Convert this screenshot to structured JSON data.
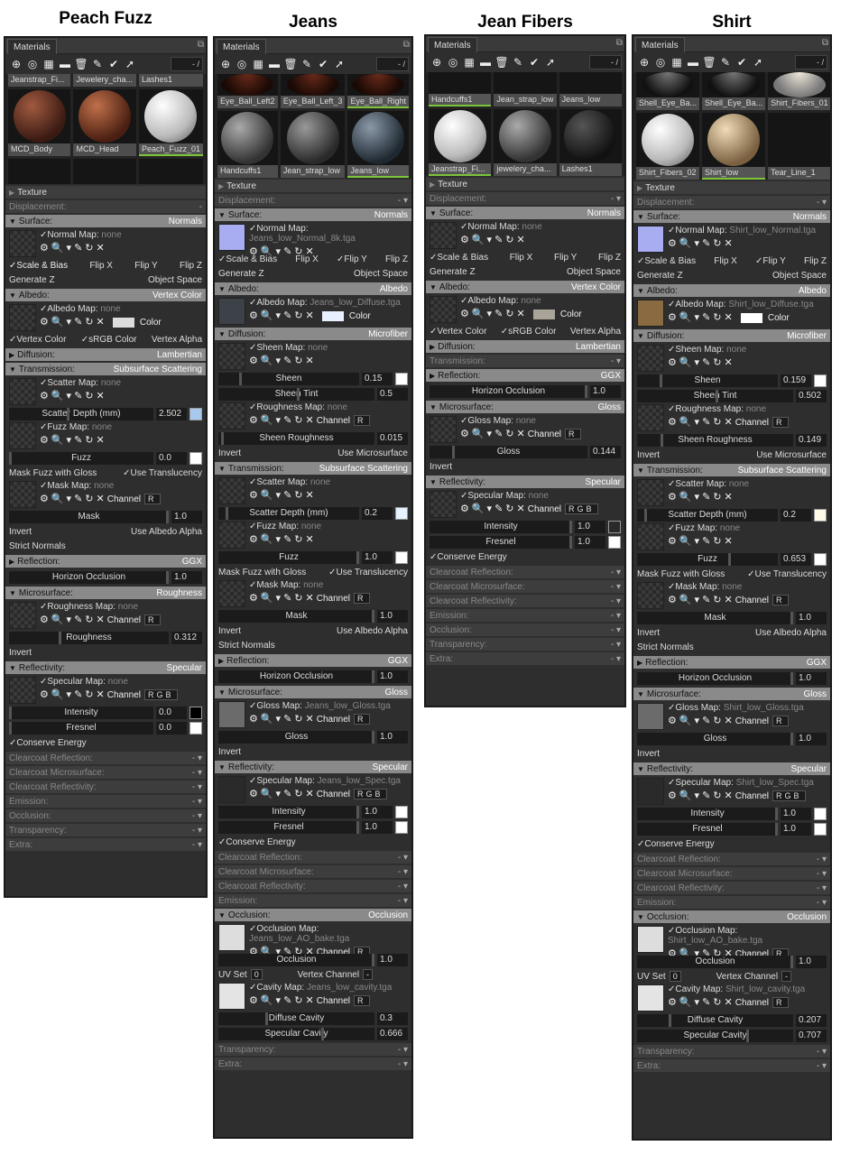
{
  "titles": [
    "Peach Fuzz",
    "Jeans",
    "Jean Fibers",
    "Shirt"
  ],
  "tab": "Materials",
  "pager": "- /",
  "icons": {
    "new": "plus-circle-icon",
    "dup": "duplicate-icon",
    "checker": "checker-icon",
    "folder": "folder-icon",
    "trash": "trash-icon",
    "eyedrop": "eyedropper-icon",
    "check": "check-circle-icon",
    "import": "import-icon"
  },
  "p1": {
    "thumb_labels": [
      "Jeanstrap_Fi...",
      "Jewelery_cha...",
      "Lashes1",
      "MCD_Body",
      "MCD_Head",
      "Peach_Fuzz_01"
    ],
    "texture": "Texture",
    "displacement": "Displacement:",
    "dv": "-",
    "surface": "Surface:",
    "surface_v": "Normals",
    "normal_map": "Normal Map:",
    "none": "none",
    "scale_bias": "Scale & Bias",
    "flip_x": "Flip X",
    "flip_y": "Flip Y",
    "flip_z": "Flip Z",
    "gen_z": "Generate Z",
    "obj_space": "Object Space",
    "albedo": "Albedo:",
    "albedo_v": "Vertex Color",
    "albedo_map": "Albedo Map:",
    "color": "Color",
    "vertex_color": "Vertex Color",
    "srgb": "sRGB Color",
    "vertex_alpha": "Vertex Alpha",
    "diffusion": "Diffusion:",
    "diffusion_v": "Lambertian",
    "transmission": "Transmission:",
    "transmission_v": "Subsurface Scattering",
    "scatter_map": "Scatter Map:",
    "scatter_depth": "Scatter Depth (mm)",
    "scatter_depth_v": "2.502",
    "fuzz_map": "Fuzz Map:",
    "fuzz": "Fuzz",
    "fuzz_v": "0.0",
    "mask_fuzz": "Mask Fuzz with Gloss",
    "use_transl": "Use Translucency",
    "mask_map": "Mask Map:",
    "channel": "Channel",
    "ch_r": "R",
    "mask": "Mask",
    "mask_v": "1.0",
    "invert": "Invert",
    "use_albedo_alpha": "Use Albedo Alpha",
    "strict": "Strict Normals",
    "reflection": "Reflection:",
    "reflection_v": "GGX",
    "horizon": "Horizon Occlusion",
    "horizon_v": "1.0",
    "microsurface": "Microsurface:",
    "micro_v": "Roughness",
    "rough_map": "Roughness Map:",
    "roughness": "Roughness",
    "roughness_v": "0.312",
    "invert2": "Invert",
    "reflectivity": "Reflectivity:",
    "refl_v": "Specular",
    "spec_map": "Specular Map:",
    "ch_rgb": "RGB",
    "intensity": "Intensity",
    "intensity_v": "0.0",
    "fresnel": "Fresnel",
    "fresnel_v": "0.0",
    "conserve": "Conserve Energy",
    "disabled": [
      "Clearcoat Reflection:",
      "Clearcoat Microsurface:",
      "Clearcoat Reflectivity:",
      "Emission:",
      "Occlusion:",
      "Transparency:",
      "Extra:"
    ]
  },
  "p2": {
    "thumb_labels": [
      "Eye_Ball_Left2",
      "Eye_Ball_Left_3",
      "Eye_Ball_Right",
      "Handcuffs1",
      "Jean_strap_low",
      "Jeans_low"
    ],
    "texture": "Texture",
    "displacement": "Displacement:",
    "surface": "Surface:",
    "surface_v": "Normals",
    "normal_map": "Normal Map:",
    "normal_file": "Jeans_low_Normal_8k.tga",
    "scale_bias": "Scale & Bias",
    "flip_x": "Flip X",
    "flip_y": "Flip Y",
    "flip_z": "Flip Z",
    "gen_z": "Generate Z",
    "obj_space": "Object Space",
    "albedo": "Albedo:",
    "albedo_v": "Albedo",
    "albedo_map": "Albedo Map:",
    "albedo_file": "Jeans_low_Diffuse.tga",
    "color": "Color",
    "diffusion": "Diffusion:",
    "diffusion_v": "Microfiber",
    "sheen_map": "Sheen Map:",
    "none": "none",
    "sheen": "Sheen",
    "sheen_v": "0.15",
    "sheen_tint": "Sheen Tint",
    "sheen_tint_v": "0.5",
    "rough_map": "Roughness Map:",
    "channel": "Channel",
    "ch_r": "R",
    "sheen_rough": "Sheen Roughness",
    "sheen_rough_v": "0.015",
    "invert": "Invert",
    "use_micro": "Use Microsurface",
    "transmission": "Transmission:",
    "transmission_v": "Subsurface Scattering",
    "scatter_map": "Scatter Map:",
    "scatter_depth": "Scatter Depth (mm)",
    "scatter_depth_v": "0.2",
    "fuzz_map": "Fuzz Map:",
    "fuzz": "Fuzz",
    "fuzz_v": "1.0",
    "mask_fuzz": "Mask Fuzz with Gloss",
    "use_transl": "Use Translucency",
    "mask_map": "Mask Map:",
    "mask": "Mask",
    "mask_v": "1.0",
    "use_albedo_alpha": "Use Albedo Alpha",
    "strict": "Strict Normals",
    "reflection": "Reflection:",
    "reflection_v": "GGX",
    "horizon": "Horizon Occlusion",
    "horizon_v": "1.0",
    "microsurface": "Microsurface:",
    "micro_v": "Gloss",
    "gloss_map": "Gloss Map:",
    "gloss_file": "Jeans_low_Gloss.tga",
    "gloss": "Gloss",
    "gloss_v": "1.0",
    "reflectivity": "Reflectivity:",
    "refl_v": "Specular",
    "spec_map": "Specular Map:",
    "spec_file": "Jeans_low_Spec.tga",
    "ch_rgb": "RGB",
    "intensity": "Intensity",
    "intensity_v": "1.0",
    "fresnel": "Fresnel",
    "fresnel_v": "1.0",
    "conserve": "Conserve Energy",
    "disabled": [
      "Clearcoat Reflection:",
      "Clearcoat Microsurface:",
      "Clearcoat Reflectivity:",
      "Emission:"
    ],
    "occlusion": "Occlusion:",
    "occlusion_v": "Occlusion",
    "occ_map": "Occlusion Map:",
    "occ_file": "Jeans_low_AO_bake.tga",
    "occ": "Occlusion",
    "occ_v": "1.0",
    "uv_set": "UV Set",
    "uv_v": "0",
    "vertex_channel": "Vertex Channel",
    "vc_v": "-",
    "cavity_map": "Cavity Map:",
    "cavity_file": "Jeans_low_cavity.tga",
    "diffuse_cavity": "Diffuse Cavity",
    "diffuse_cavity_v": "0.3",
    "spec_cavity": "Specular Cavity",
    "spec_cavity_v": "0.666",
    "disabled2": [
      "Transparency:",
      "Extra:"
    ]
  },
  "p3": {
    "thumb_labels": [
      "Handcuffs1",
      "Jean_strap_low",
      "Jeans_low",
      "Jeanstrap_Fi...",
      "jewelery_cha...",
      "Lashes1"
    ],
    "texture": "Texture",
    "displacement": "Displacement:",
    "surface": "Surface:",
    "surface_v": "Normals",
    "normal_map": "Normal Map:",
    "none": "none",
    "scale_bias": "Scale & Bias",
    "flip_x": "Flip X",
    "flip_y": "Flip Y",
    "flip_z": "Flip Z",
    "gen_z": "Generate Z",
    "obj_space": "Object Space",
    "albedo": "Albedo:",
    "albedo_v": "Vertex Color",
    "albedo_map": "Albedo Map:",
    "color": "Color",
    "vertex_color": "Vertex Color",
    "srgb": "sRGB Color",
    "vertex_alpha": "Vertex Alpha",
    "diffusion": "Diffusion:",
    "diffusion_v": "Lambertian",
    "transmission": "Transmission:",
    "reflection": "Reflection:",
    "reflection_v": "GGX",
    "horizon": "Horizon Occlusion",
    "horizon_v": "1.0",
    "microsurface": "Microsurface:",
    "micro_v": "Gloss",
    "gloss_map": "Gloss Map:",
    "channel": "Channel",
    "ch_r": "R",
    "gloss": "Gloss",
    "gloss_v": "0.144",
    "invert": "Invert",
    "reflectivity": "Reflectivity:",
    "refl_v": "Specular",
    "spec_map": "Specular Map:",
    "ch_rgb": "RGB",
    "intensity": "Intensity",
    "intensity_v": "1.0",
    "fresnel": "Fresnel",
    "fresnel_v": "1.0",
    "conserve": "Conserve Energy",
    "disabled": [
      "Clearcoat Reflection:",
      "Clearcoat Microsurface:",
      "Clearcoat Reflectivity:",
      "Emission:",
      "Occlusion:",
      "Transparency:",
      "Extra:"
    ]
  },
  "p4": {
    "thumb_labels": [
      "Shell_Eye_Ba...",
      "Shell_Eye_Ba...",
      "Shirt_Fibers_01",
      "Shirt_Fibers_02",
      "Shirt_low",
      "Tear_Line_1"
    ],
    "texture": "Texture",
    "displacement": "Displacement:",
    "surface": "Surface:",
    "surface_v": "Normals",
    "normal_map": "Normal Map:",
    "normal_file": "Shirt_low_Normal.tga",
    "scale_bias": "Scale & Bias",
    "flip_x": "Flip X",
    "flip_y": "Flip Y",
    "flip_z": "Flip Z",
    "gen_z": "Generate Z",
    "obj_space": "Object Space",
    "albedo": "Albedo:",
    "albedo_v": "Albedo",
    "albedo_map": "Albedo Map:",
    "albedo_file": "Shirt_low_Diffuse.tga",
    "color": "Color",
    "diffusion": "Diffusion:",
    "diffusion_v": "Microfiber",
    "sheen_map": "Sheen Map:",
    "none": "none",
    "sheen": "Sheen",
    "sheen_v": "0.159",
    "sheen_tint": "Sheen Tint",
    "sheen_tint_v": "0.502",
    "rough_map": "Roughness Map:",
    "channel": "Channel",
    "ch_r": "R",
    "sheen_rough": "Sheen Roughness",
    "sheen_rough_v": "0.149",
    "invert": "Invert",
    "use_micro": "Use Microsurface",
    "transmission": "Transmission:",
    "transmission_v": "Subsurface Scattering",
    "scatter_map": "Scatter Map:",
    "scatter_depth": "Scatter Depth (mm)",
    "scatter_depth_v": "0.2",
    "fuzz_map": "Fuzz Map:",
    "fuzz": "Fuzz",
    "fuzz_v": "0.653",
    "mask_fuzz": "Mask Fuzz with Gloss",
    "use_transl": "Use Translucency",
    "mask_map": "Mask Map:",
    "mask": "Mask",
    "mask_v": "1.0",
    "use_albedo_alpha": "Use Albedo Alpha",
    "strict": "Strict Normals",
    "reflection": "Reflection:",
    "reflection_v": "GGX",
    "horizon": "Horizon Occlusion",
    "horizon_v": "1.0",
    "microsurface": "Microsurface:",
    "micro_v": "Gloss",
    "gloss_map": "Gloss Map:",
    "gloss_file": "Shirt_low_Gloss.tga",
    "gloss": "Gloss",
    "gloss_v": "1.0",
    "reflectivity": "Reflectivity:",
    "refl_v": "Specular",
    "spec_map": "Specular Map:",
    "spec_file": "Shirt_low_Spec.tga",
    "ch_rgb": "RGB",
    "intensity": "Intensity",
    "intensity_v": "1.0",
    "fresnel": "Fresnel",
    "fresnel_v": "1.0",
    "conserve": "Conserve Energy",
    "disabled": [
      "Clearcoat Reflection:",
      "Clearcoat Microsurface:",
      "Clearcoat Reflectivity:",
      "Emission:"
    ],
    "occlusion": "Occlusion:",
    "occlusion_v": "Occlusion",
    "occ_map": "Occlusion Map:",
    "occ_file": "Shirt_low_AO_bake.tga",
    "occ": "Occlusion",
    "occ_v": "1.0",
    "uv_set": "UV Set",
    "uv_v": "0",
    "vertex_channel": "Vertex Channel",
    "vc_v": "-",
    "cavity_map": "Cavity Map:",
    "cavity_file": "Shirt_low_cavity.tga",
    "diffuse_cavity": "Diffuse Cavity",
    "diffuse_cavity_v": "0.207",
    "spec_cavity": "Specular Cavity",
    "spec_cavity_v": "0.707",
    "disabled2": [
      "Transparency:",
      "Extra:"
    ]
  }
}
